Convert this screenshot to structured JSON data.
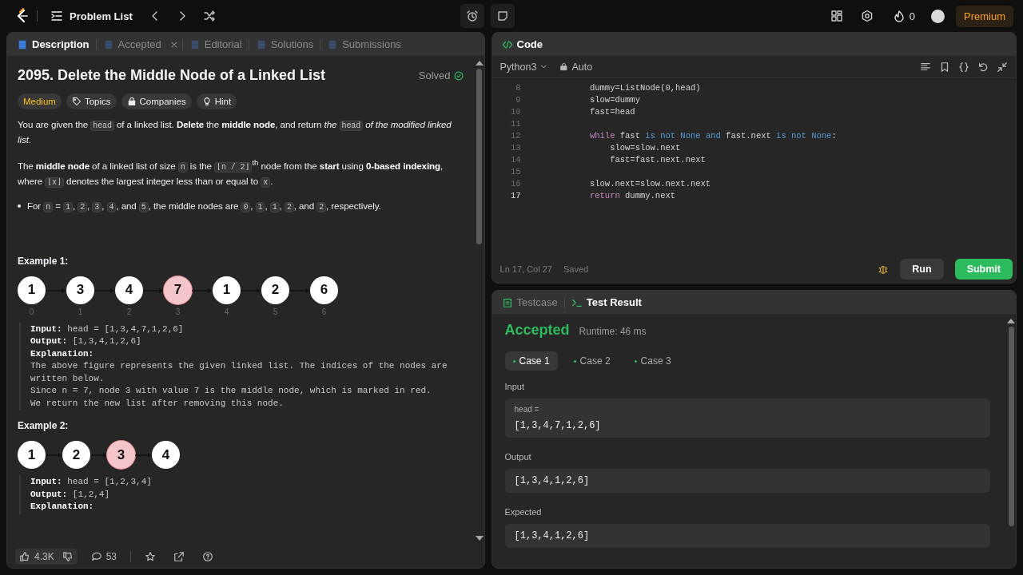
{
  "topbar": {
    "problem_list": "Problem List",
    "streak": "0",
    "premium": "Premium"
  },
  "left_tabs": [
    {
      "label": "Description",
      "selected": true,
      "closable": false
    },
    {
      "label": "Accepted",
      "selected": false,
      "closable": true
    },
    {
      "label": "Editorial",
      "selected": false,
      "closable": false
    },
    {
      "label": "Solutions",
      "selected": false,
      "closable": false
    },
    {
      "label": "Submissions",
      "selected": false,
      "closable": false
    }
  ],
  "problem": {
    "title": "2095. Delete the Middle Node of a Linked List",
    "status": "Solved",
    "difficulty": "Medium",
    "tags": [
      "Topics",
      "Companies",
      "Hint"
    ]
  },
  "paragraphs": [
    {
      "kind": "para",
      "segments": [
        {
          "kind": "text",
          "text": "You are given the "
        },
        {
          "kind": "code",
          "text": "head"
        },
        {
          "kind": "text",
          "text": " of a linked list. **Delete** the **middle node**, and return *the* "
        },
        {
          "kind": "code",
          "text": "head"
        },
        {
          "kind": "text",
          "text": " *of the modified linked list*."
        }
      ]
    },
    {
      "kind": "para",
      "segments": [
        {
          "kind": "text",
          "text": "The **middle node** of a linked list of size "
        },
        {
          "kind": "code",
          "text": "n"
        },
        {
          "kind": "text",
          "text": " is the "
        },
        {
          "kind": "code",
          "text": "⌊n / 2⌋"
        },
        {
          "kind": "text",
          "text": "$^{th}$ node from the **start** using **0-based indexing**, where "
        },
        {
          "kind": "code",
          "text": "⌊x⌋"
        },
        {
          "kind": "text",
          "text": " denotes the largest integer less than or equal to "
        },
        {
          "kind": "code",
          "text": "x"
        },
        {
          "kind": "text",
          "text": "."
        }
      ]
    },
    {
      "kind": "bullet",
      "segments": [
        {
          "kind": "text",
          "text": "For "
        },
        {
          "kind": "code",
          "text": "n"
        },
        {
          "kind": "text",
          "text": " = "
        },
        {
          "kind": "code",
          "text": "1"
        },
        {
          "kind": "text",
          "text": ", "
        },
        {
          "kind": "code",
          "text": "2"
        },
        {
          "kind": "text",
          "text": ", "
        },
        {
          "kind": "code",
          "text": "3"
        },
        {
          "kind": "text",
          "text": ", "
        },
        {
          "kind": "code",
          "text": "4"
        },
        {
          "kind": "text",
          "text": ", and "
        },
        {
          "kind": "code",
          "text": "5"
        },
        {
          "kind": "text",
          "text": ", the middle nodes are "
        },
        {
          "kind": "code",
          "text": "0"
        },
        {
          "kind": "text",
          "text": ", "
        },
        {
          "kind": "code",
          "text": "1"
        },
        {
          "kind": "text",
          "text": ", "
        },
        {
          "kind": "code",
          "text": "1"
        },
        {
          "kind": "text",
          "text": ", "
        },
        {
          "kind": "code",
          "text": "2"
        },
        {
          "kind": "text",
          "text": ", and "
        },
        {
          "kind": "code",
          "text": "2"
        },
        {
          "kind": "text",
          "text": ", respectively."
        }
      ]
    }
  ],
  "examples": [
    {
      "heading": "Example 1:",
      "nodes": [
        {
          "value": "1",
          "index": "0",
          "highlighted": false
        },
        {
          "value": "3",
          "index": "1",
          "highlighted": false
        },
        {
          "value": "4",
          "index": "2",
          "highlighted": false
        },
        {
          "value": "7",
          "index": "3",
          "highlighted": true
        },
        {
          "value": "1",
          "index": "4",
          "highlighted": false
        },
        {
          "value": "2",
          "index": "5",
          "highlighted": false
        },
        {
          "value": "6",
          "index": "6",
          "highlighted": false
        }
      ],
      "lines": [
        {
          "label": "Input:",
          "text": "head = [1,3,4,7,1,2,6]"
        },
        {
          "label": "Output:",
          "text": "[1,3,4,1,2,6]"
        },
        {
          "label": "Explanation:"
        },
        {
          "text": "The above figure represents the given linked list. The indices of the nodes are written below."
        },
        {
          "text": "Since n = 7, node 3 with value 7 is the middle node, which is marked in red."
        },
        {
          "text": "We return the new list after removing this node."
        }
      ]
    },
    {
      "heading": "Example 2:",
      "nodes": [
        {
          "value": "1",
          "highlighted": false
        },
        {
          "value": "2",
          "highlighted": false
        },
        {
          "value": "3",
          "highlighted": true
        },
        {
          "value": "4",
          "highlighted": false
        }
      ],
      "lines": [
        {
          "label": "Input:",
          "text": "head = [1,2,3,4]"
        },
        {
          "label": "Output:",
          "text": "[1,2,4]"
        },
        {
          "label": "Explanation:"
        }
      ]
    }
  ],
  "footer": {
    "likes": "4.3K",
    "comments": "53"
  },
  "code": {
    "title": "Code",
    "language": "Python3",
    "mode": "Auto",
    "lines": [
      {
        "number": "8",
        "current": false,
        "segments": [
          {
            "kind": "plain",
            "text": "        dummy=ListNode(0,head)"
          }
        ]
      },
      {
        "number": "9",
        "current": false,
        "segments": [
          {
            "kind": "plain",
            "text": "        slow=dummy"
          }
        ]
      },
      {
        "number": "10",
        "current": false,
        "segments": [
          {
            "kind": "plain",
            "text": "        fast=head"
          }
        ]
      },
      {
        "number": "11",
        "current": false
      },
      {
        "number": "12",
        "current": false,
        "segments": [
          {
            "kind": "control",
            "text": "        while"
          },
          {
            "kind": "plain",
            "text": " fast "
          },
          {
            "kind": "keyword",
            "text": "is not None and"
          },
          {
            "kind": "plain",
            "text": " fast.next "
          },
          {
            "kind": "keyword",
            "text": "is not None"
          },
          {
            "kind": "plain",
            "text": ":"
          }
        ]
      },
      {
        "number": "13",
        "current": false,
        "segments": [
          {
            "kind": "plain",
            "text": "            slow=slow.next"
          }
        ]
      },
      {
        "number": "14",
        "current": false,
        "segments": [
          {
            "kind": "plain",
            "text": "            fast=fast.next.next"
          }
        ]
      },
      {
        "number": "15",
        "current": false
      },
      {
        "number": "16",
        "current": false,
        "segments": [
          {
            "kind": "plain",
            "text": "        slow.next=slow.next.next"
          }
        ]
      },
      {
        "number": "17",
        "current": true,
        "segments": [
          {
            "kind": "control",
            "text": "        return"
          },
          {
            "kind": "plain",
            "text": " dummy.next"
          }
        ]
      }
    ],
    "cursor": "Ln 17, Col 27",
    "save_state": "Saved",
    "run": "Run",
    "submit": "Submit"
  },
  "bottom_tabs": [
    {
      "label": "Testcase",
      "selected": false
    },
    {
      "label": "Test Result",
      "selected": true
    }
  ],
  "result": {
    "verdict": "Accepted",
    "runtime": "Runtime: 46 ms",
    "cases": [
      {
        "label": "Case 1",
        "selected": true
      },
      {
        "label": "Case 2",
        "selected": false
      },
      {
        "label": "Case 3",
        "selected": false
      }
    ],
    "input_label": "Input",
    "input_var": "head =",
    "input_value": "[1,3,4,7,1,2,6]",
    "output_label": "Output",
    "output_value": "[1,3,4,1,2,6]",
    "expected_label": "Expected",
    "expected_value": "[1,3,4,1,2,6]"
  }
}
